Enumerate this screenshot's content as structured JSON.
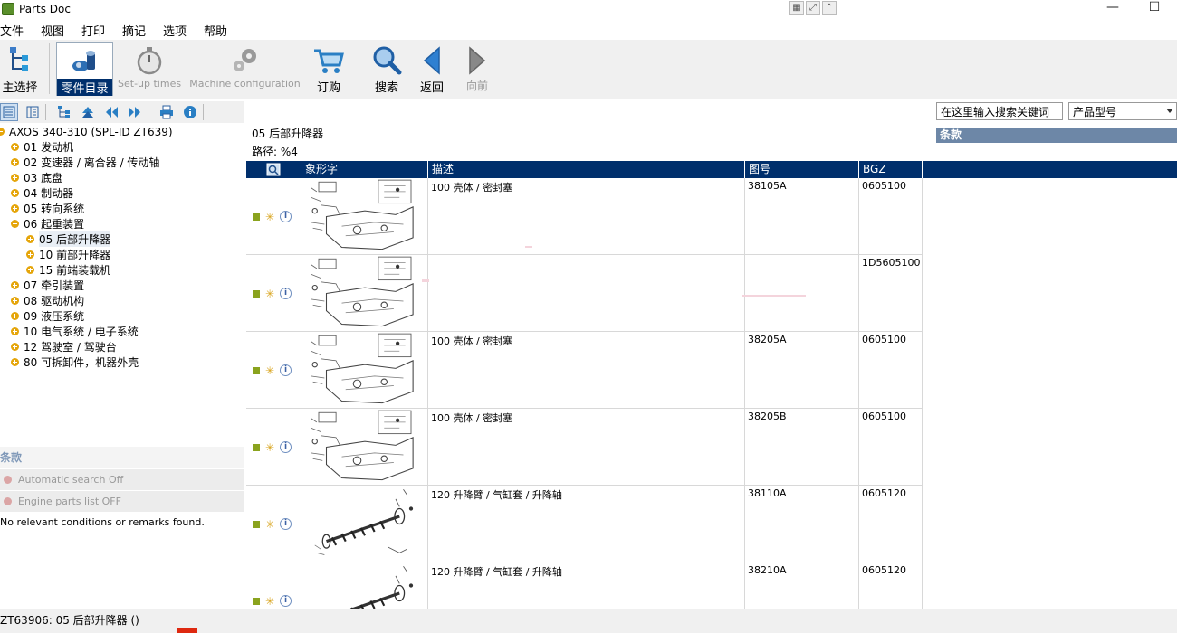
{
  "window": {
    "title": "Parts Doc",
    "minimize": "—",
    "maximize": "☐"
  },
  "menu": [
    "文件",
    "视图",
    "打印",
    "摘记",
    "选项",
    "帮助"
  ],
  "toolbar": {
    "main_select": "主选择",
    "parts_catalog": "零件目录",
    "setup_times": "Set-up times",
    "machine_config": "Machine configuration",
    "order": "订购",
    "search": "搜索",
    "back": "返回",
    "forward": "向前"
  },
  "search": {
    "placeholder": "在这里输入搜索关键词",
    "product_type": "产品型号",
    "terms_label": "条款"
  },
  "tree": {
    "root": "AXOS 340-310   (SPL-ID ZT639)",
    "items": [
      {
        "label": "01 发动机",
        "level": 1,
        "expanded": false
      },
      {
        "label": "02 变速器 / 离合器 / 传动轴",
        "level": 1,
        "expanded": false
      },
      {
        "label": "03 底盘",
        "level": 1,
        "expanded": false
      },
      {
        "label": "04 制动器",
        "level": 1,
        "expanded": false
      },
      {
        "label": "05 转向系统",
        "level": 1,
        "expanded": false
      },
      {
        "label": "06 起重装置",
        "level": 1,
        "expanded": true
      },
      {
        "label": "05 后部升降器",
        "level": 2,
        "expanded": false,
        "selected": true
      },
      {
        "label": "10 前部升降器",
        "level": 2,
        "expanded": false
      },
      {
        "label": "15 前端装载机",
        "level": 2,
        "expanded": false
      },
      {
        "label": "07 牵引装置",
        "level": 1,
        "expanded": false
      },
      {
        "label": "08 驱动机构",
        "level": 1,
        "expanded": false
      },
      {
        "label": "09 液压系统",
        "level": 1,
        "expanded": false
      },
      {
        "label": "10 电气系统 / 电子系统",
        "level": 1,
        "expanded": false
      },
      {
        "label": "12 驾驶室 / 驾驶台",
        "level": 1,
        "expanded": false
      },
      {
        "label": "80 可拆卸件，机器外壳",
        "level": 1,
        "expanded": false
      }
    ]
  },
  "terms_panel": {
    "header": "条款",
    "conditions": [
      "Automatic search Off",
      "Engine parts list OFF"
    ],
    "no_conditions": "No relevant conditions or remarks found."
  },
  "status": {
    "text": "ZT63906: 05 后部升降器 ()"
  },
  "main": {
    "breadcrumb": "05 后部升降器",
    "path": "路径:  %4",
    "columns": {
      "pictogram": "象形字",
      "description": "描述",
      "drawing_no": "图号",
      "bgz": "BGZ"
    },
    "rows": [
      {
        "description": "100 壳体 / 密封塞",
        "drawing_no": "38105A",
        "bgz": "0605100",
        "pic": "housing"
      },
      {
        "description": "",
        "drawing_no": "",
        "bgz": "1D5605100",
        "pic": "housing"
      },
      {
        "description": "100 壳体 / 密封塞",
        "drawing_no": "38205A",
        "bgz": "0605100",
        "pic": "housing"
      },
      {
        "description": "100 壳体 / 密封塞",
        "drawing_no": "38205B",
        "bgz": "0605100",
        "pic": "housing"
      },
      {
        "description": "120 升降臂 / 气缸套 / 升降轴",
        "drawing_no": "38110A",
        "bgz": "0605120",
        "pic": "shaft"
      },
      {
        "description": "120 升降臂 / 气缸套 / 升降轴",
        "drawing_no": "38210A",
        "bgz": "0605120",
        "pic": "shaft"
      }
    ]
  },
  "colors": {
    "header_bg": "#002f6c",
    "tree_bullet": "#e5a50a",
    "terms_bar": "#6d87a7"
  },
  "icons": {
    "main_select": "tree-structure-icon",
    "parts_catalog": "parts-bolt-icon",
    "setup_times": "stopwatch-icon",
    "machine_config": "gears-icon",
    "order": "shopping-cart-icon",
    "search": "magnifier-icon",
    "back": "arrow-left-icon",
    "forward": "arrow-right-icon"
  }
}
